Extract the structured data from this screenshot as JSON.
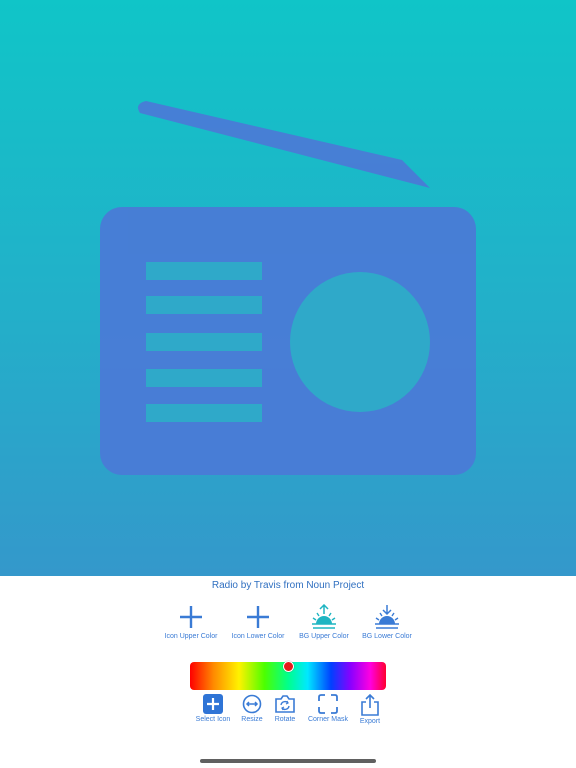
{
  "attribution": "Radio by Travis from Noun Project",
  "colors": {
    "icon_fill": "#4b7ad7",
    "bg_top": "#10c5c8",
    "bg_bottom": "#3498cb",
    "accent": "#3a7bd5"
  },
  "color_buttons": [
    {
      "label": "Icon Upper Color",
      "icon": "plus-icon"
    },
    {
      "label": "Icon Lower Color",
      "icon": "plus-icon"
    },
    {
      "label": "BG Upper Color",
      "icon": "sunrise-icon"
    },
    {
      "label": "BG Lower Color",
      "icon": "sunset-icon"
    }
  ],
  "color_slider": {
    "value_fraction": 0.5
  },
  "toolbar": [
    {
      "label": "Select Icon",
      "icon": "plus-square-icon"
    },
    {
      "label": "Resize",
      "icon": "resize-arrows-icon"
    },
    {
      "label": "Rotate",
      "icon": "rotate-camera-icon"
    },
    {
      "label": "Corner Mask",
      "icon": "corner-mask-icon"
    },
    {
      "label": "Export",
      "icon": "share-icon"
    }
  ]
}
